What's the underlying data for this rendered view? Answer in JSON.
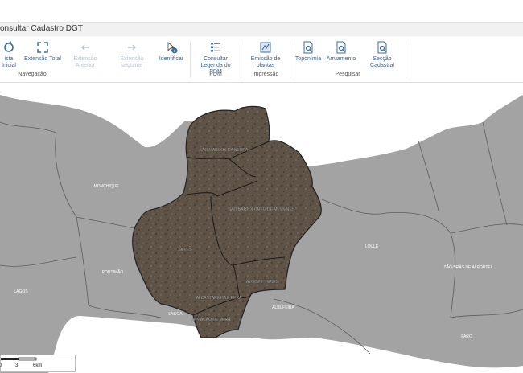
{
  "app": {
    "tab_title": "onsultar Cadastro DGT"
  },
  "ribbon": {
    "buttons": {
      "vista_inicial": "ista Inicial",
      "extensao_total": "Extensão Total",
      "extensao_anterior": "Extensão Anterior",
      "extensao_seguinte": "Extensão seguinte",
      "identificar": "Identificar",
      "consultar_legenda": "Consultar Legenda do PDM",
      "emissao_plantas": "Emissão de plantas",
      "toponimia": "Toponímia",
      "arruamento": "Arruamento",
      "seccao_cadastral": "Secção Cadastral"
    },
    "groups": {
      "navegacao": "Navegação",
      "pdm": "PDM",
      "impressao": "Impressão",
      "pesquisar": "Pesquisar"
    }
  },
  "map": {
    "labels": {
      "sao_marcos": "SÃO MARCOS DA SERRA",
      "sao_bartolomeu": "SÃO BARTOLOMEU DE MESSINES",
      "silves": "SILVES",
      "algoz_tunes": "ALGOZ E TUNES",
      "alcantarilha": "ALCANTARILHA E PÊRA",
      "armacao": "ARMAÇÃO DE PÊRA",
      "albufeira": "ALBUFEIRA",
      "monchique": "MONCHIQUE",
      "portimao": "PORTIMÃO",
      "lagoa": "LAGOA",
      "lagos": "LAGOS",
      "loule": "LOULÉ",
      "sao_bras": "SÃO BRÁS DE ALPORTEL",
      "faro": "FARO"
    }
  },
  "scale": {
    "labels": [
      "0",
      "3",
      "6km"
    ]
  },
  "colors": {
    "water": "#ffffff",
    "neighbor": "#a3a3a3",
    "boundary": "#5d5d5d",
    "silves_land": "#5f5347",
    "accent": "#3a6ea5"
  }
}
